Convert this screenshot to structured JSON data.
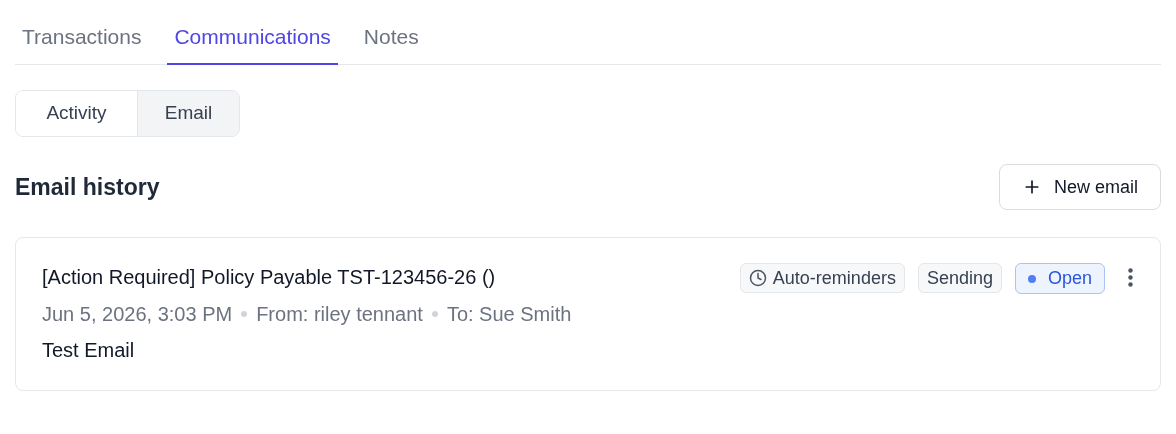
{
  "tabs": [
    {
      "label": "Transactions",
      "selected": false
    },
    {
      "label": "Communications",
      "selected": true
    },
    {
      "label": "Notes",
      "selected": false
    }
  ],
  "segments": [
    {
      "label": "Activity",
      "selected": false
    },
    {
      "label": "Email",
      "selected": true
    }
  ],
  "section": {
    "title": "Email history",
    "new_button": "New email"
  },
  "emails": [
    {
      "subject": "[Action Required] Policy Payable TST-123456-26 ()",
      "meta": [
        "Jun 5, 2026, 3:03 PM",
        "From: riley tennant",
        "To: Sue Smith"
      ],
      "body": "Test Email",
      "badges": [
        {
          "kind": "reminder",
          "label": "Auto-reminders"
        },
        {
          "kind": "plain",
          "label": "Sending"
        },
        {
          "kind": "status",
          "label": "Open",
          "color": "#4f7ff0"
        }
      ]
    }
  ]
}
